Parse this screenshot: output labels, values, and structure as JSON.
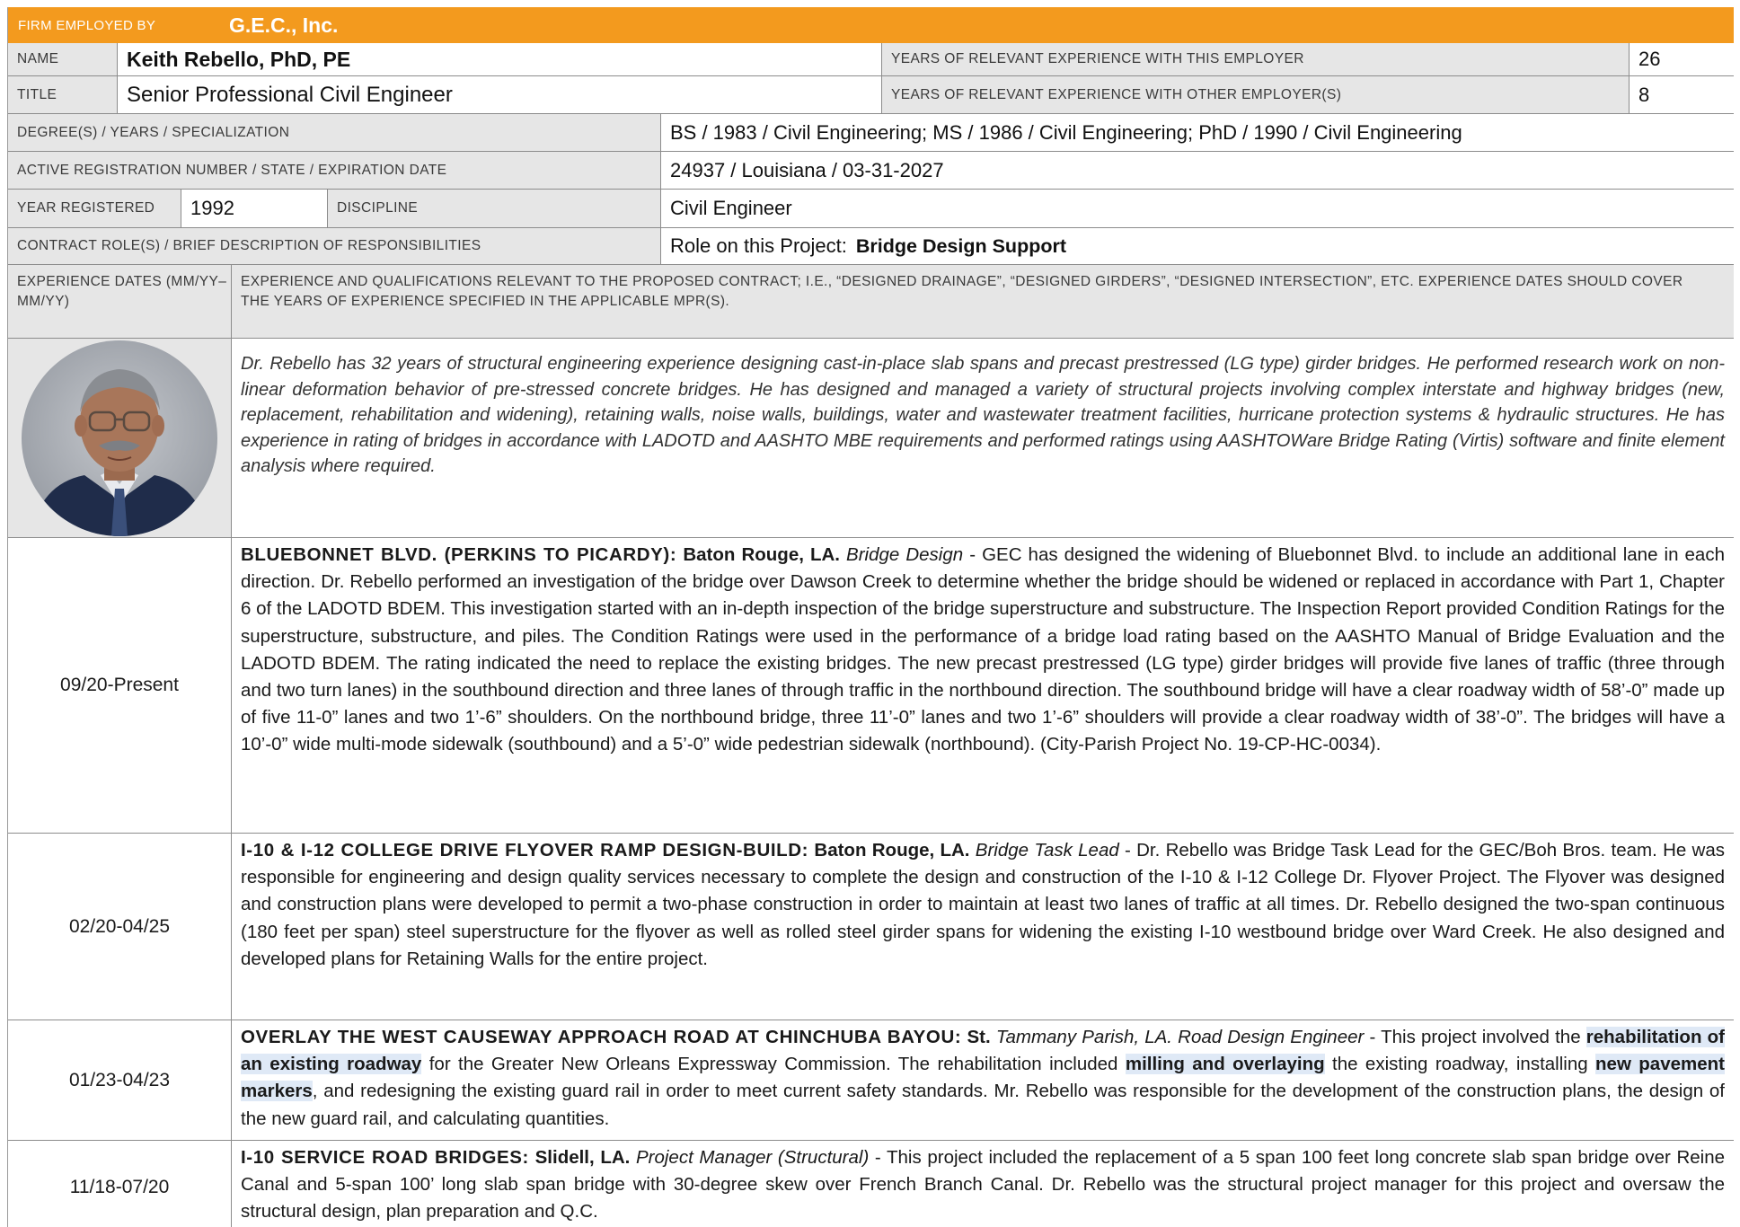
{
  "header": {
    "firm_label": "FIRM EMPLOYED BY",
    "firm_name": "G.E.C., Inc."
  },
  "name": {
    "label": "NAME",
    "value": "Keith Rebello, PhD, PE"
  },
  "years_this": {
    "label": "YEARS OF RELEVANT EXPERIENCE WITH THIS EMPLOYER",
    "value": "26"
  },
  "title": {
    "label": "TITLE",
    "value": "Senior Professional Civil Engineer"
  },
  "years_other": {
    "label": "YEARS OF RELEVANT EXPERIENCE WITH OTHER EMPLOYER(S)",
    "value": "8"
  },
  "degrees": {
    "label": "DEGREE(S) / YEARS / SPECIALIZATION",
    "value": "BS / 1983 / Civil Engineering; MS / 1986 / Civil Engineering; PhD / 1990 / Civil Engineering"
  },
  "registration": {
    "label": "ACTIVE REGISTRATION NUMBER / STATE / EXPIRATION DATE",
    "value": "24937 / Louisiana / 03-31-2027"
  },
  "year_registered": {
    "label": "YEAR REGISTERED",
    "value": "1992"
  },
  "discipline": {
    "label": "DISCIPLINE",
    "value": "Civil Engineer"
  },
  "contract_role": {
    "label": "CONTRACT ROLE(S) / BRIEF DESCRIPTION OF RESPONSIBILITIES",
    "prefix": "Role on this Project:",
    "value": "Bridge Design Support"
  },
  "table_header": {
    "dates_label": "EXPERIENCE DATES (MM/YY–MM/YY)",
    "experience_label": "EXPERIENCE AND QUALIFICATIONS RELEVANT TO THE PROPOSED CONTRACT; I.E., “DESIGNED DRAINAGE”, “DESIGNED GIRDERS”, “DESIGNED INTERSECTION”, ETC.  EXPERIENCE DATES SHOULD COVER THE YEARS OF EXPERIENCE SPECIFIED IN THE APPLICABLE MPR(S)."
  },
  "summary": "Dr. Rebello has 32 years of structural engineering experience designing cast-in-place slab spans and precast prestressed (LG type) girder bridges. He performed research work on non-linear deformation behavior of pre-stressed concrete bridges. He has designed and managed a variety of structural projects involving complex interstate and highway bridges (new, replacement, rehabilitation and widening), retaining walls, noise walls, buildings, water and wastewater treatment facilities, hurricane protection systems & hydraulic structures. He has experience in rating of bridges in accordance with LADOTD and AASHTO MBE requirements and performed ratings using AASHTOWare Bridge Rating (Virtis) software and finite element analysis where required.",
  "projects": [
    {
      "dates": "09/20-Present",
      "title": "BLUEBONNET BLVD. (PERKINS TO PICARDY):",
      "location": "Baton Rouge, LA.",
      "role": "Bridge Design",
      "description": "- GEC has designed the widening of Bluebonnet Blvd. to include an additional lane in each direction. Dr. Rebello performed an investigation of the bridge over Dawson Creek to determine whether the bridge should be widened or replaced in accordance with Part 1, Chapter 6 of the LADOTD BDEM. This investigation started with an in-depth inspection of the bridge superstructure and substructure. The Inspection Report provided Condition Ratings for the superstructure, substructure, and piles. The Condition Ratings were used in the performance of a bridge load rating based on the AASHTO Manual of Bridge Evaluation and the LADOTD BDEM. The rating indicated the need to replace the existing bridges. The new precast prestressed (LG type) girder bridges will provide five lanes of traffic (three through and two turn lanes) in the southbound direction and three lanes of through traffic in the northbound direction. The southbound bridge will have a clear roadway width of 58’-0” made up of five 11-0” lanes and two 1’-6” shoulders.  On the northbound bridge, three 11’-0” lanes and two 1’-6” shoulders will provide a clear roadway width of 38’-0”. The bridges will have a 10’-0” wide multi-mode sidewalk (southbound) and a 5’-0” wide pedestrian sidewalk (northbound). (City-Parish Project No. 19-CP-HC-0034)."
    },
    {
      "dates": "02/20-04/25",
      "title": "I-10 & I-12 COLLEGE DRIVE FLYOVER RAMP DESIGN-BUILD:",
      "location": "Baton Rouge, LA.",
      "role": "Bridge Task Lead",
      "description": "- Dr. Rebello was Bridge Task Lead for the GEC/Boh Bros. team.  He was responsible for engineering and design quality services necessary to complete the design and construction of the I-10 & I-12 College Dr. Flyover Project.  The Flyover was designed and construction plans were developed to permit a two-phase construction in order to maintain at least two lanes of traffic at all times.  Dr. Rebello designed the two-span continuous (180 feet per span) steel superstructure for the flyover as well as rolled steel girder spans for widening the existing I-10 westbound bridge over Ward Creek. He also designed and developed plans for Retaining Walls for the entire project."
    },
    {
      "dates": "01/23-04/23",
      "title": "OVERLAY THE WEST CAUSEWAY APPROACH ROAD AT CHINCHUBA BAYOU:",
      "location": "St.",
      "role": "Tammany Parish, LA. Road Design Engineer",
      "d1": "- This project involved the",
      "h1": "rehabilitation of an existing roadway",
      "d2": "for the Greater New Orleans Expressway Commission. The rehabilitation included",
      "h2": "milling and overlaying",
      "d3": "the existing roadway, installing",
      "h3": "new pavement markers",
      "d4": ", and redesigning the existing guard rail in order to meet current safety standards. Mr. Rebello was responsible for the development of the construction plans, the design of the new guard rail, and calculating quantities."
    },
    {
      "dates": "11/18-07/20",
      "title": "I-10 SERVICE ROAD BRIDGES:",
      "location": "Slidell, LA.",
      "role": "Project Manager (Structural)",
      "description": "- This project included the replacement of a 5 span 100 feet long concrete slab span bridge over Reine Canal and 5-span 100’ long slab span bridge with 30-degree skew over French Branch Canal. Dr. Rebello was the structural project manager for this project and oversaw the structural design, plan preparation and Q.C."
    }
  ],
  "colors": {
    "banner": "#F39A1E",
    "label_bg": "#E6E6E6",
    "highlight": "#DFE9F6"
  }
}
